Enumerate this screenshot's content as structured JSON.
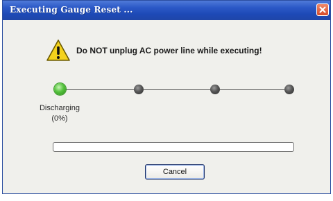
{
  "window": {
    "title": "Executing Gauge Reset ...",
    "close_icon": "close-icon"
  },
  "warning": {
    "icon": "warning-icon",
    "text": "Do NOT unplug AC power line while executing!"
  },
  "steps": {
    "items": [
      {
        "state": "active"
      },
      {
        "state": "pending"
      },
      {
        "state": "pending"
      },
      {
        "state": "pending"
      }
    ],
    "current_label_line1": "Discharging",
    "current_label_line2": "(0%)"
  },
  "progress": {
    "percent": 0
  },
  "buttons": {
    "cancel_label": "Cancel"
  },
  "colors": {
    "titlebar": "#2c59c7",
    "active_step": "#55c23d",
    "inactive_step": "#555555",
    "window_bg": "#f0f0ec"
  }
}
